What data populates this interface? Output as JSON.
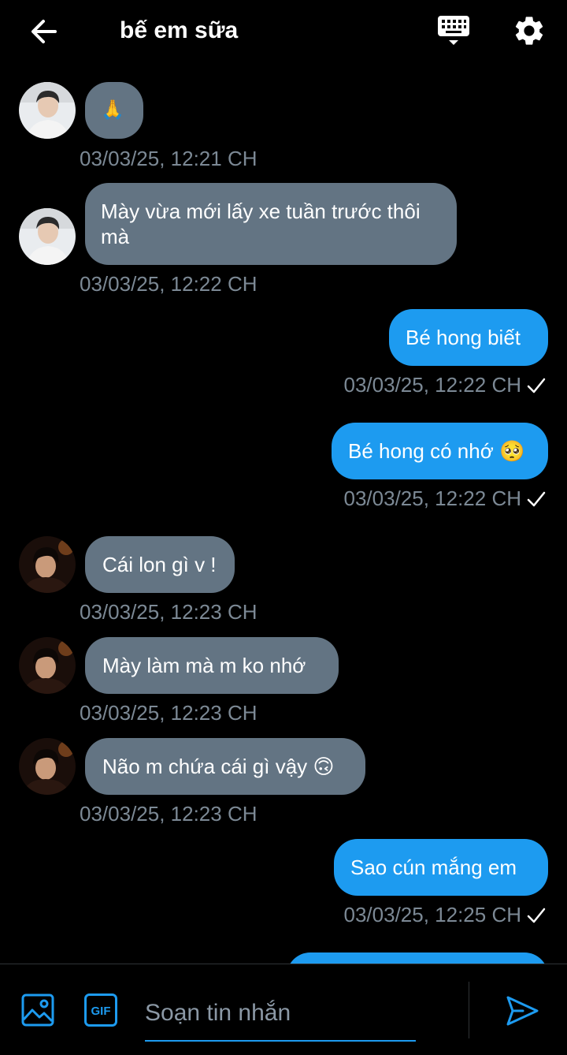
{
  "header": {
    "title": "bế em sữa",
    "back_icon": "arrow-left-icon",
    "keyboard_icon": "keyboard-icon",
    "settings_icon": "gear-icon"
  },
  "messages": [
    {
      "dir": "in",
      "text": "🙏",
      "time": "03/03/25, 12:21 CH",
      "avatar": "contact-photo-1"
    },
    {
      "dir": "in",
      "text": "Mày vừa mới lấy xe tuần trước thôi\nmà",
      "time": "03/03/25, 12:22 CH",
      "avatar": "contact-photo-1"
    },
    {
      "dir": "out",
      "text": "Bé hong biết",
      "time": "03/03/25, 12:22 CH"
    },
    {
      "dir": "out",
      "text": "Bé hong có nhớ 🥺",
      "time": "03/03/25, 12:22 CH"
    },
    {
      "dir": "in",
      "text": "Cái lon gì v !",
      "time": "03/03/25, 12:23 CH",
      "avatar": "contact-photo-2"
    },
    {
      "dir": "in",
      "text": "Mày làm mà m ko nhớ",
      "time": "03/03/25, 12:23 CH",
      "avatar": "contact-photo-2"
    },
    {
      "dir": "in",
      "text": "Não m chứa cái gì vậy 🙃",
      "time": "03/03/25, 12:23 CH",
      "avatar": "contact-photo-2"
    },
    {
      "dir": "out",
      "text": "Sao cún mắng em",
      "time": "03/03/25, 12:25 CH"
    }
  ],
  "composer": {
    "placeholder": "Soạn tin nhắn",
    "value": "",
    "image_icon": "image-icon",
    "gif_label": "GIF",
    "send_icon": "send-icon"
  },
  "colors": {
    "background": "#000000",
    "incoming_bubble": "#637483",
    "outgoing_bubble": "#1d9bf0",
    "timestamp": "#7c8995",
    "accent": "#1d9bf0"
  }
}
